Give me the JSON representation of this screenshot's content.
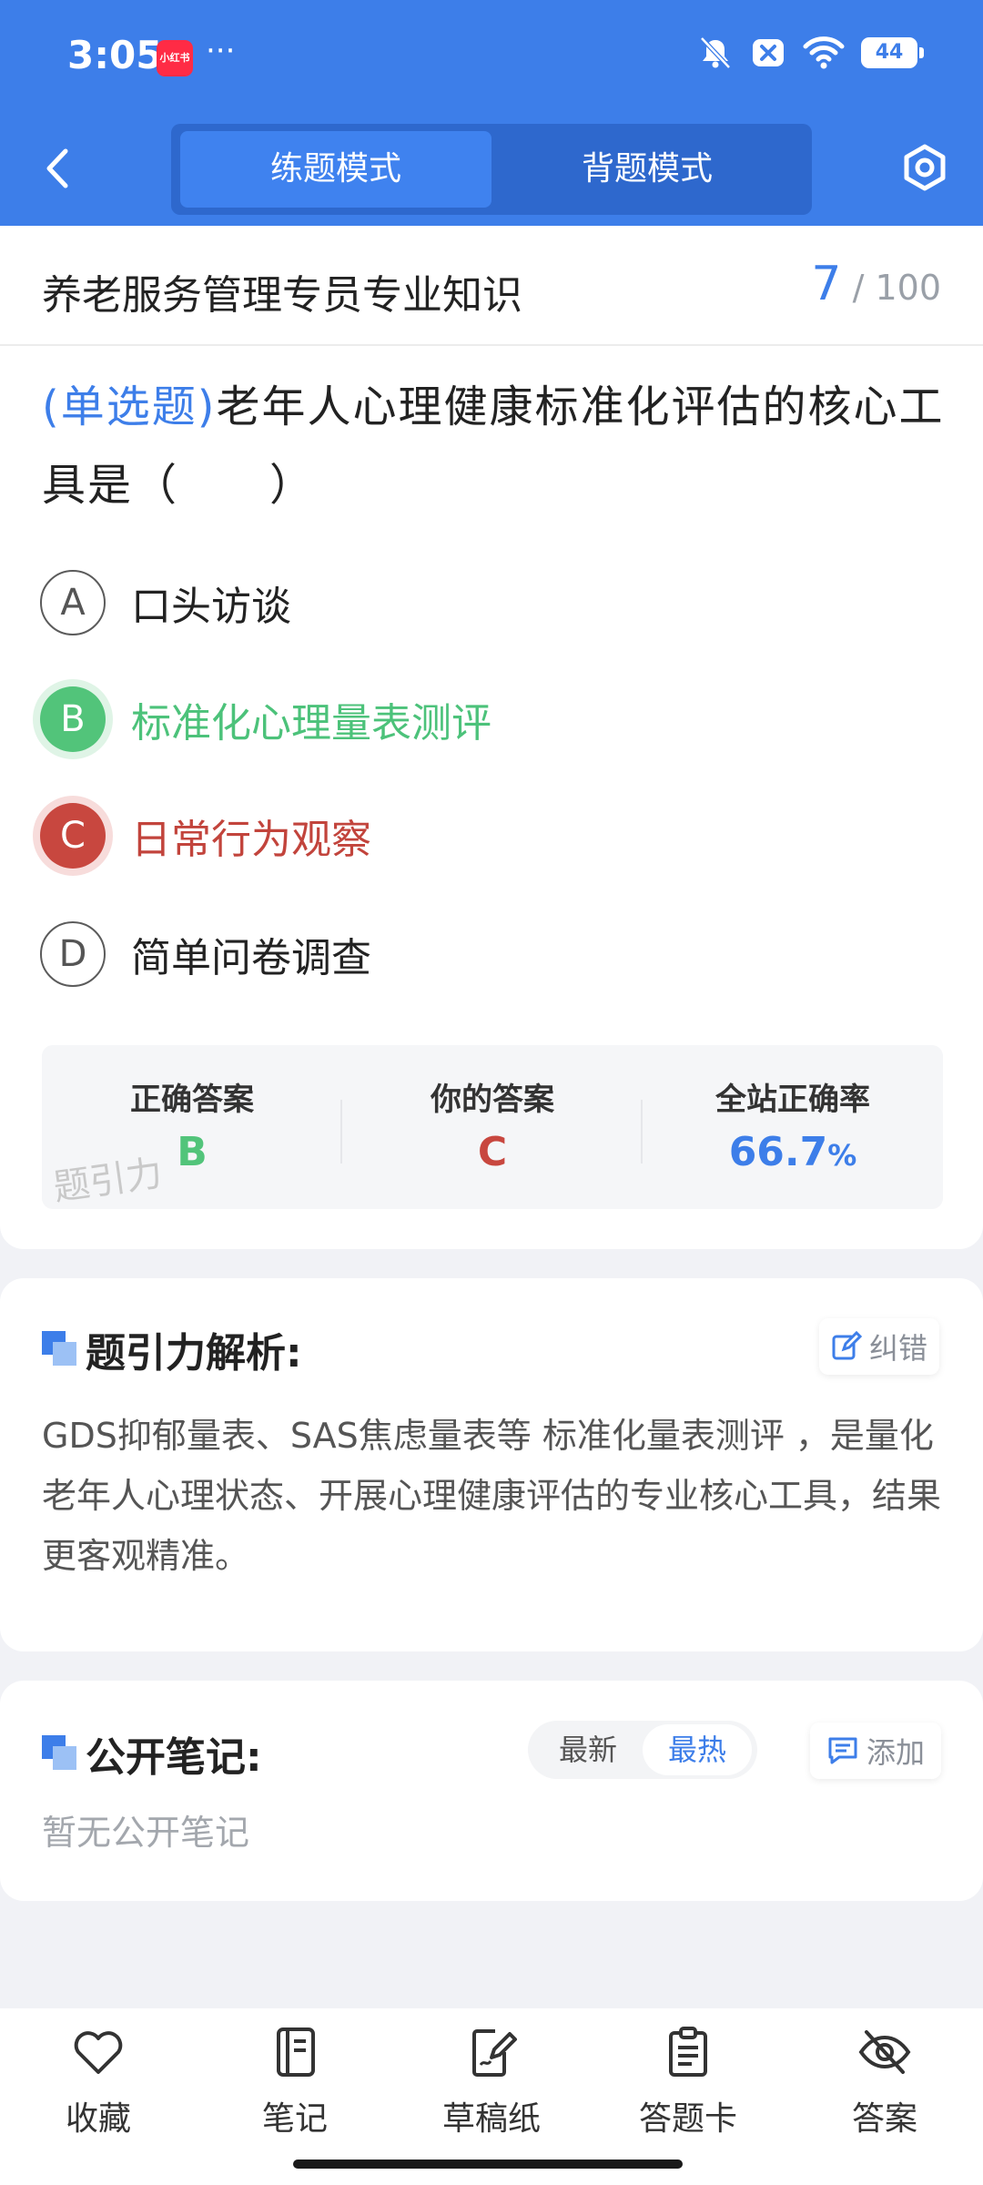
{
  "status_bar": {
    "time": "3:05",
    "app_badge": "小红书",
    "more": "···",
    "battery": "44",
    "icons": [
      "bell-mute-icon",
      "close-box-icon",
      "wifi-icon",
      "battery-icon"
    ]
  },
  "header": {
    "tabs": [
      {
        "label": "练题模式",
        "active": true
      },
      {
        "label": "背题模式",
        "active": false
      }
    ]
  },
  "question_header": {
    "subject": "养老服务管理专员专业知识",
    "current": "7",
    "total": "/ 100"
  },
  "question": {
    "type": "(单选题)",
    "text": "老年人心理健康标准化评估的核心工具是（　　）"
  },
  "options": [
    {
      "letter": "A",
      "text": "口头访谈",
      "state": "normal"
    },
    {
      "letter": "B",
      "text": "标准化心理量表测评",
      "state": "correct"
    },
    {
      "letter": "C",
      "text": "日常行为观察",
      "state": "wrong"
    },
    {
      "letter": "D",
      "text": "简单问卷调查",
      "state": "normal"
    }
  ],
  "stats": {
    "correct_label": "正确答案",
    "correct_value": "B",
    "yours_label": "你的答案",
    "yours_value": "C",
    "rate_label": "全站正确率",
    "rate_value": "66.7",
    "rate_unit": "%",
    "watermark": "题引力"
  },
  "analysis": {
    "title": "题引力解析:",
    "report_label": "纠错",
    "body": "GDS抑郁量表、SAS焦虑量表等 标准化量表测评 ，是量化老年人心理状态、开展心理健康评估的专业核心工具，结果更客观精准。"
  },
  "notes": {
    "title": "公开笔记:",
    "sort_latest": "最新",
    "sort_hot": "最热",
    "add_label": "添加",
    "empty_text": "暂无公开笔记"
  },
  "bottom_nav": [
    {
      "label": "收藏",
      "icon": "heart-icon"
    },
    {
      "label": "笔记",
      "icon": "notebook-icon"
    },
    {
      "label": "草稿纸",
      "icon": "draft-paper-icon"
    },
    {
      "label": "答题卡",
      "icon": "answer-card-icon"
    },
    {
      "label": "答案",
      "icon": "eye-off-icon"
    }
  ],
  "colors": {
    "primary": "#3d7ee9",
    "correct": "#52c47a",
    "wrong": "#c8473f"
  }
}
